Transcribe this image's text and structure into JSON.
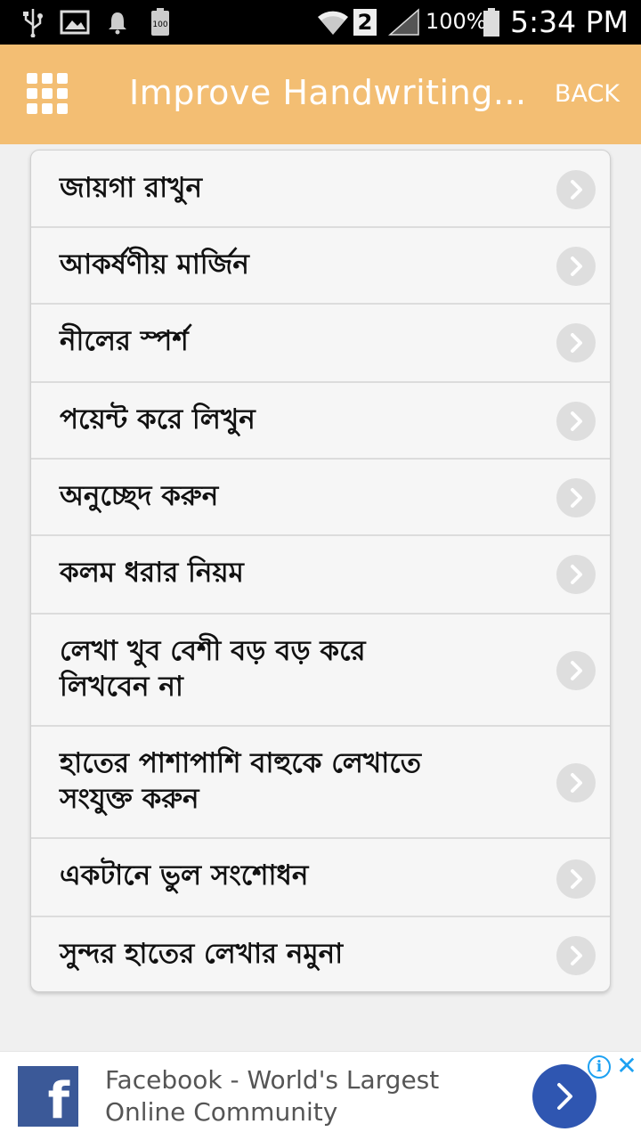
{
  "status_bar": {
    "signal_badge": "2",
    "battery_text": "100%",
    "time": "5:34 PM",
    "icons": [
      "usb-icon",
      "image-icon",
      "notification-bell-icon",
      "battery-saver-icon",
      "wifi-icon",
      "sim-badge",
      "cell-signal-icon",
      "battery-icon"
    ]
  },
  "app_bar": {
    "title": "Improve Handwriting...",
    "back_label": "BACK",
    "menu_icon": "grid-menu-icon",
    "background_color": "#f3be73"
  },
  "list": {
    "items": [
      {
        "label": "জায়গা রাখুন"
      },
      {
        "label": "আকর্ষণীয় মার্জিন"
      },
      {
        "label": "নীলের স্পর্শ"
      },
      {
        "label": "পয়েন্ট করে লিখুন"
      },
      {
        "label": "অনুচ্ছেদ করুন"
      },
      {
        "label": "কলম ধরার নিয়ম"
      },
      {
        "label": "লেখা খুব বেশী বড় বড় করে লিখবেন না"
      },
      {
        "label": "হাতের পাশাপাশি বাহুকে লেখাতে সংযুক্ত করুন"
      },
      {
        "label": "একটানে ভুল সংশোধন"
      },
      {
        "label": "সুন্দর হাতের লেখার নমুনা"
      }
    ],
    "item_icon": "chevron-right-icon"
  },
  "ad": {
    "brand_letter": "f",
    "text_line1": "Facebook - World's Largest",
    "text_line2": "Online Community",
    "info_glyph": "i",
    "close_glyph": "✕",
    "brand_color": "#3b5998",
    "button_color": "#2f56b1"
  }
}
